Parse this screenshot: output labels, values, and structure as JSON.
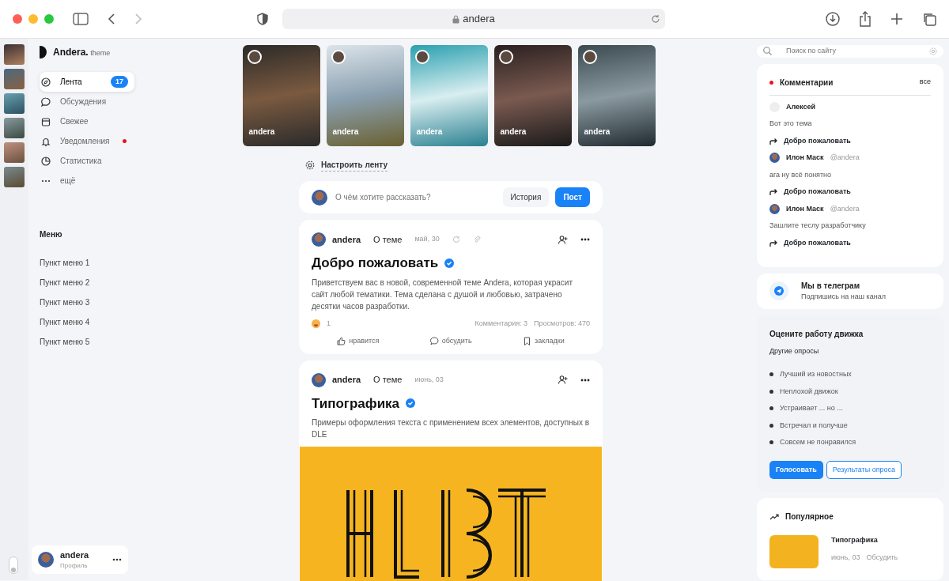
{
  "browser": {
    "url": "andera"
  },
  "rail": [
    {
      "kind": "photo"
    },
    {
      "kind": "photo"
    },
    {
      "kind": "photo"
    },
    {
      "kind": "photo"
    },
    {
      "kind": "photo"
    },
    {
      "kind": "photo"
    }
  ],
  "sidebar": {
    "logo": "Andera.",
    "logo_suffix": "theme",
    "nav": [
      {
        "label": "Лента",
        "badge": "17",
        "unread": false,
        "selected": true
      },
      {
        "label": "Обсуждения",
        "unread": false,
        "selected": false
      },
      {
        "label": "Свежее",
        "unread": false,
        "selected": false
      },
      {
        "label": "Уведомления",
        "unread": true,
        "selected": false
      },
      {
        "label": "Статистика",
        "unread": false,
        "selected": false
      },
      {
        "label": "ещё",
        "unread": false,
        "selected": false
      }
    ],
    "menu_title": "Меню",
    "menu": [
      "Пункт меню 1",
      "Пункт меню 2",
      "Пункт меню 3",
      "Пункт меню 4",
      "Пункт меню 5"
    ],
    "theme_toggle": {
      "on": false
    },
    "profile": {
      "name": "andera",
      "subtitle": "Профиль"
    }
  },
  "stories": [
    {
      "author": "andera"
    },
    {
      "author": "andera"
    },
    {
      "author": "andera"
    },
    {
      "author": "andera"
    },
    {
      "author": "andera"
    }
  ],
  "feed_settings": "Настроить ленту",
  "composer": {
    "placeholder": "О чём хотите рассказать?",
    "buttons": [
      "История",
      "Пост"
    ]
  },
  "posts": [
    {
      "kind": "text",
      "author": "andera",
      "topic": "О теме",
      "date": "май, 30",
      "attachments": true,
      "title": "Добро пожаловать",
      "verified": true,
      "text": "Приветствуем вас в новой, современной теме Andera, которая украсит сайт любой тематики. Тема сделана с душой и любовью, затрачено десятки часов разработки.",
      "reactions": "1",
      "comments": "Комментария: 3",
      "views": "Просмотров: 470",
      "actions": [
        "нравится",
        "обсудить",
        "закладки"
      ]
    },
    {
      "kind": "image",
      "author": "andera",
      "topic": "О теме",
      "date": "июнь, 03",
      "attachments": false,
      "title": "Типографика",
      "verified": true,
      "text": "Примеры оформления текста с применением всех элементов, доступных в DLE"
    }
  ],
  "search": {
    "placeholder": "Поиск по сайту"
  },
  "comments": {
    "title": "Комментарии",
    "all": "все",
    "items": [
      {
        "author": "Алексей",
        "avatar": false,
        "text": "Вот это тема",
        "link": "Добро пожаловать"
      },
      {
        "author": "Илон Маск",
        "avatar": true,
        "handle": "@andera",
        "text": "ага ну всё понятно",
        "link": "Добро пожаловать"
      },
      {
        "author": "Илон Маск",
        "avatar": true,
        "handle": "@andera",
        "text": "Зашлите теслу разработчику",
        "link": "Добро пожаловать"
      }
    ]
  },
  "telegram": {
    "title": "Мы в телеграм",
    "subtitle": "Подпишись на наш канал"
  },
  "poll": {
    "title": "Оцените работу движка",
    "subtitle": "Другие опросы",
    "options": [
      "Лучший из новостных",
      "Неплохой движок",
      "Устраивает ... но ...",
      "Встречал и получше",
      "Совсем не понравился"
    ],
    "vote": "Голосовать",
    "results": "Результаты опроса"
  },
  "popular": {
    "title": "Популярное",
    "items": [
      {
        "title": "Типографика",
        "date": "июнь, 03",
        "action": "Обсудить"
      }
    ]
  }
}
